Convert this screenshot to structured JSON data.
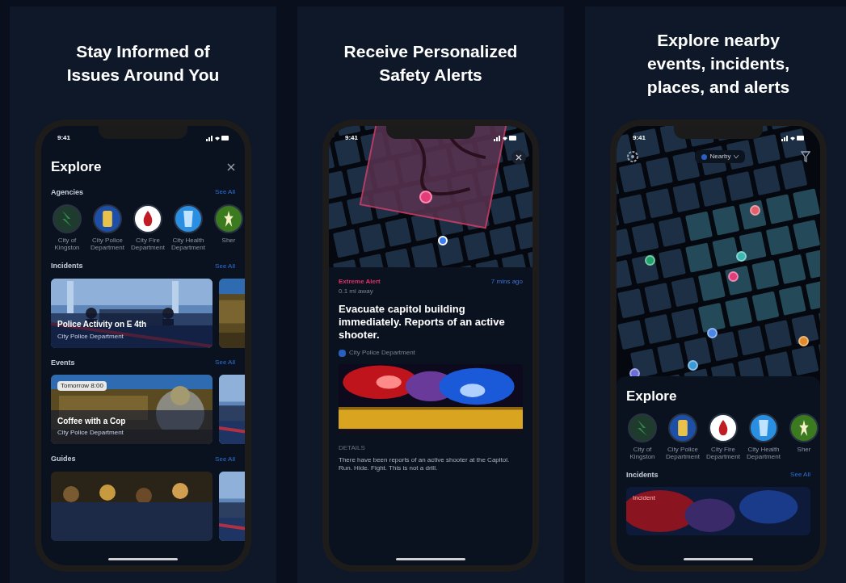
{
  "panels": [
    {
      "kind": "explore",
      "headline": "Stay Informed of Issues Around You",
      "phone": {
        "time": "9:41",
        "title": "Explore",
        "sections": [
          {
            "kind": "agencies",
            "title": "Agencies",
            "link": "See All",
            "items": [
              {
                "label": "City of Kingston",
                "color": "#1f3b2e"
              },
              {
                "label": "City Police Department",
                "color": "#1d4fa8"
              },
              {
                "label": "City Fire Department",
                "color": "#ffffff"
              },
              {
                "label": "City Health Department",
                "color": "#2a8fe0"
              },
              {
                "label": "Sher",
                "color": "#3c7a1f"
              }
            ]
          },
          {
            "kind": "cards",
            "title": "Incidents",
            "link": "See All",
            "cards": [
              {
                "kind": "police",
                "title": "Police Activity on E 4th",
                "source": "City Police Department"
              }
            ]
          },
          {
            "kind": "cards",
            "title": "Events",
            "link": "See All",
            "cards": [
              {
                "kind": "coffee",
                "badge": "Tomorrow 8:00",
                "title": "Coffee with a Cop",
                "source": "City Police Department"
              }
            ]
          },
          {
            "kind": "cards",
            "title": "Guides",
            "link": "See All",
            "cards": [
              {
                "kind": "crowd"
              }
            ]
          }
        ]
      }
    },
    {
      "kind": "alert",
      "headline": "Receive Personalized Safety Alerts",
      "phone": {
        "time": "9:41",
        "level": "Extreme Alert",
        "distance": "0.1 mi away",
        "age": "7 mins ago",
        "title": "Evacuate capitol building immediately. Reports of an active shooter.",
        "source": "City Police Department",
        "details_label": "DETAILS",
        "details": "There have been reports of an active shooter at the Capitol. Run. Hide. Fight. This is not a drill."
      }
    },
    {
      "kind": "map",
      "headline": "Explore nearby events, incidents, places, and alerts",
      "phone": {
        "time": "9:41",
        "location": "Nearby",
        "title": "Explore",
        "pins": [
          {
            "color": "#e0606c"
          },
          {
            "color": "#1fa36a"
          },
          {
            "color": "#3bb8b0"
          },
          {
            "color": "#e23d7a"
          },
          {
            "color": "#4a86e8"
          },
          {
            "color": "#e08a2a"
          },
          {
            "color": "#3a9ad9"
          },
          {
            "color": "#6b6fd8"
          }
        ],
        "agencies": [
          {
            "label": "City of Kingston",
            "color": "#1f3b2e"
          },
          {
            "label": "City Police Department",
            "color": "#1d4fa8"
          },
          {
            "label": "City Fire Department",
            "color": "#ffffff"
          },
          {
            "label": "City Health Department",
            "color": "#2a8fe0"
          },
          {
            "label": "Sher",
            "color": "#3c7a1f"
          }
        ],
        "section": {
          "title": "Incidents",
          "link": "See All",
          "badge": "Incident"
        }
      }
    }
  ]
}
